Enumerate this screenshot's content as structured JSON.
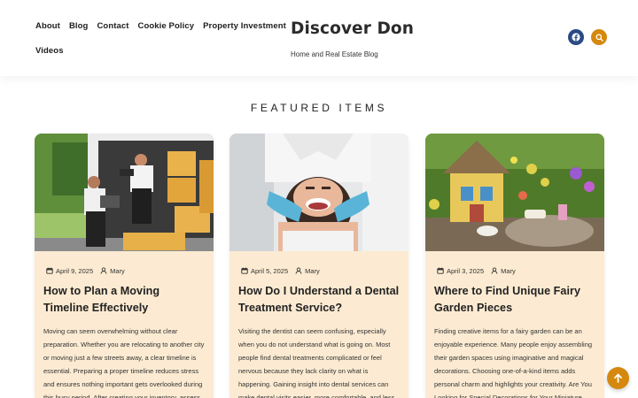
{
  "nav": {
    "row1": [
      "About",
      "Blog",
      "Contact",
      "Cookie Policy",
      "Property Investment"
    ],
    "row2": [
      "Videos"
    ]
  },
  "brand": {
    "title": "Discover Don",
    "tagline": "Home and Real Estate Blog"
  },
  "icons": {
    "facebook": "facebook-icon",
    "search": "search-icon",
    "to_top": "arrow-up-icon",
    "calendar": "calendar-icon",
    "user": "user-icon"
  },
  "colors": {
    "accent": "#d4880e",
    "facebook": "#2a4a86",
    "card_bg": "#fcebd2"
  },
  "section": {
    "title": "FEATURED ITEMS"
  },
  "cards": [
    {
      "date": "April 9, 2025",
      "author": "Mary",
      "title": "How to Plan a Moving Timeline Effectively",
      "excerpt": "Moving can seem overwhelming without clear preparation. Whether you are relocating to another city or moving just a few streets away, a clear timeline is essential. Preparing a proper timeline reduces stress and ensures nothing important gets overlooked during this busy period. After creating your inventory, assess"
    },
    {
      "date": "April 5, 2025",
      "author": "Mary",
      "title": "How Do I Understand a Dental Treatment Service?",
      "excerpt": "Visiting the dentist can seem confusing, especially when you do not understand what is going on. Most people find dental treatments complicated or feel nervous because they lack clarity on what is happening. Gaining insight into dental services can make dental visits easier, more comfortable, and less"
    },
    {
      "date": "April 3, 2025",
      "author": "Mary",
      "title": "Where to Find Unique Fairy Garden Pieces",
      "excerpt": "Finding creative items for a fairy garden can be an enjoyable experience. Many people enjoy assembling their garden spaces using imaginative and magical decorations. Choosing one-of-a-kind items adds personal charm and highlights your creativity. Are You Looking for Special Decorations for Your Miniature"
    }
  ]
}
